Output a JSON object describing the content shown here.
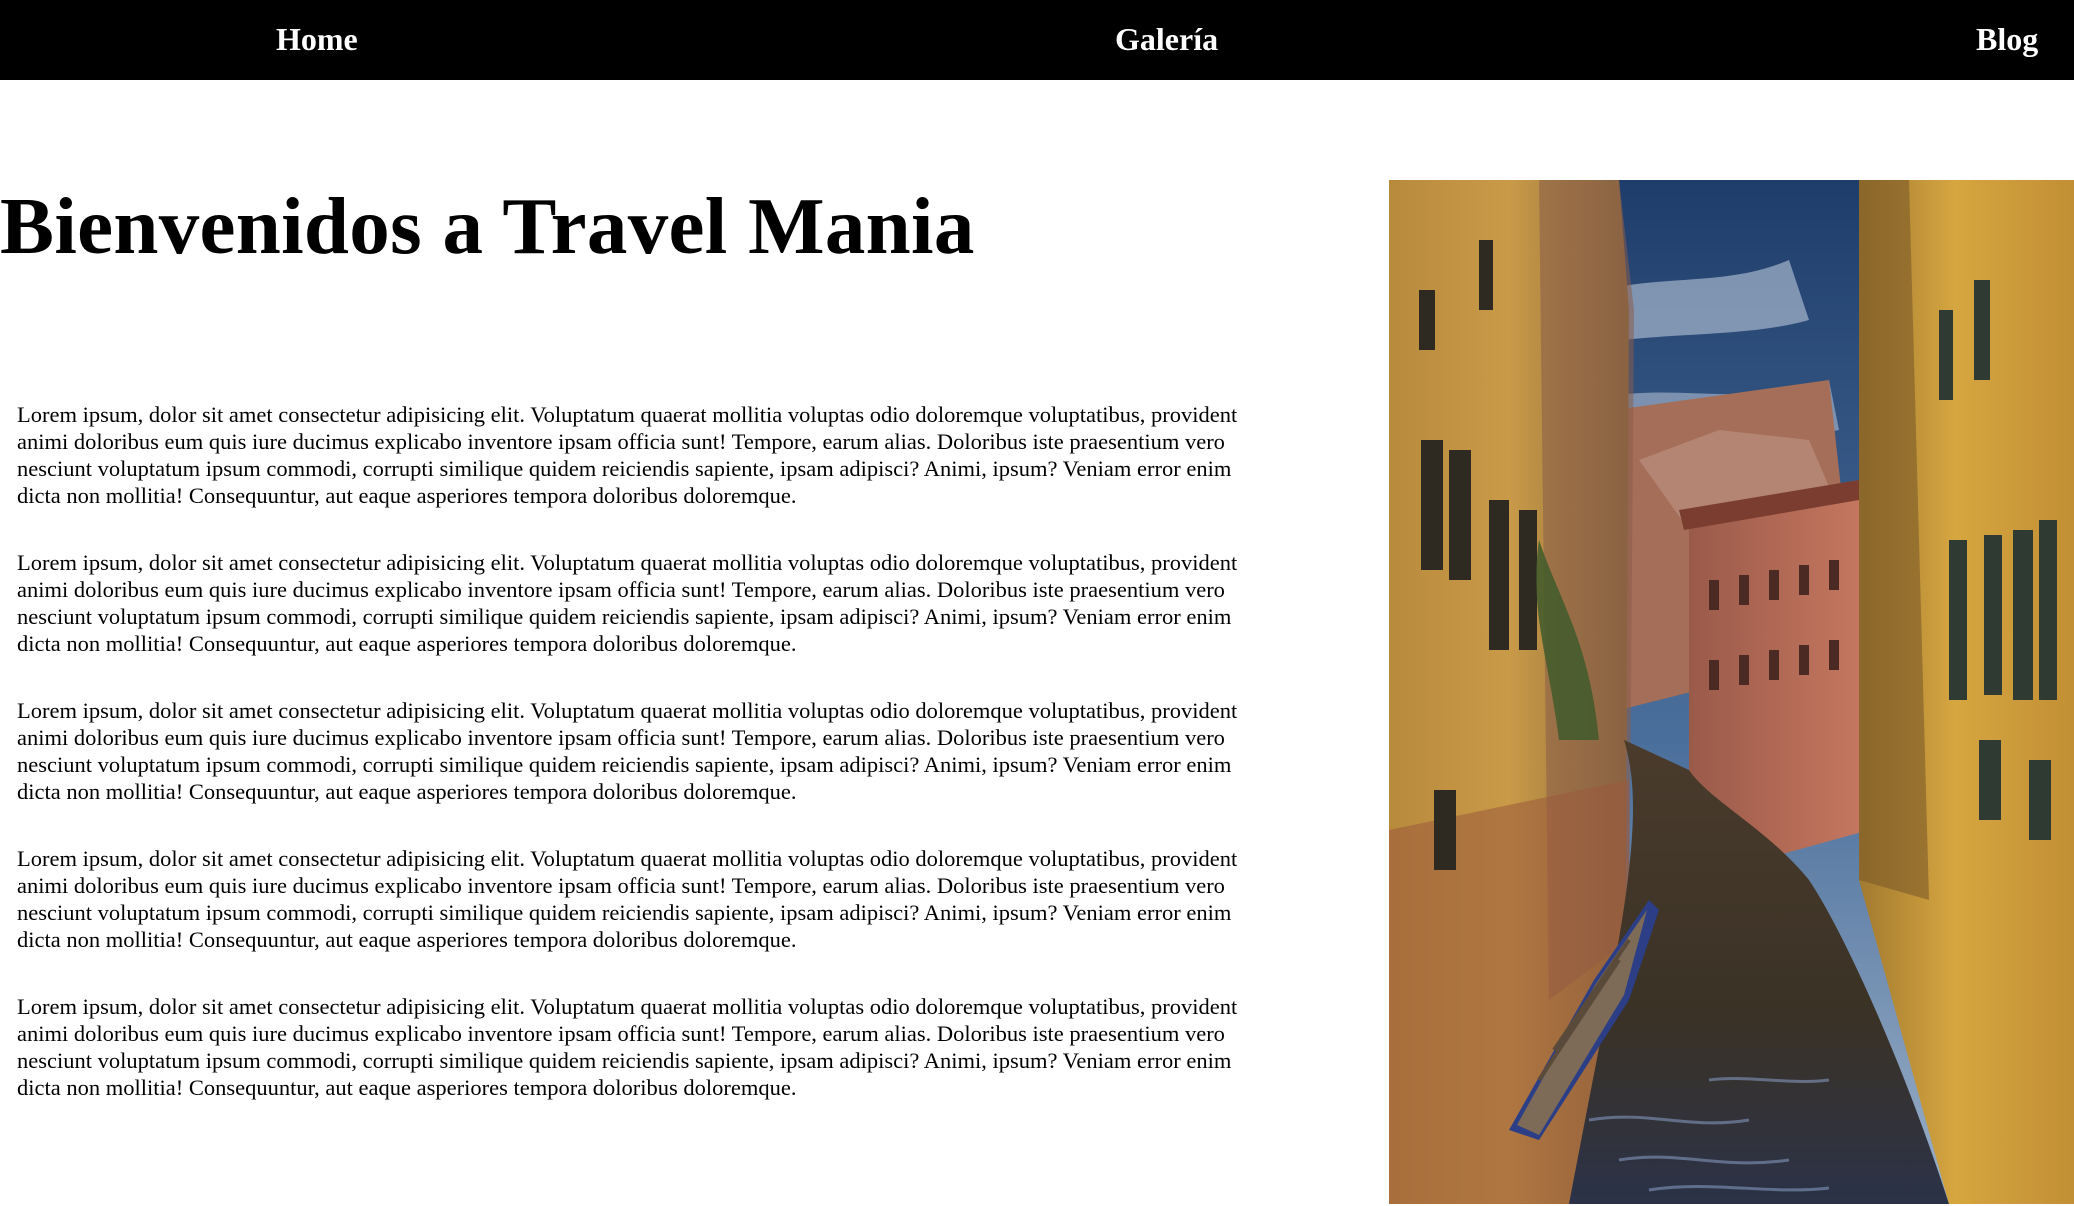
{
  "nav": {
    "items": [
      {
        "label": "Home"
      },
      {
        "label": "Galería"
      },
      {
        "label": "Blog"
      }
    ]
  },
  "main": {
    "title": "Bienvenidos a Travel Mania",
    "paragraphs": [
      "Lorem ipsum, dolor sit amet consectetur adipisicing elit. Voluptatum quaerat mollitia voluptas odio doloremque voluptatibus, provident animi doloribus eum quis iure ducimus explicabo inventore ipsam officia sunt! Tempore, earum alias. Doloribus iste praesentium vero nesciunt voluptatum ipsum commodi, corrupti similique quidem reiciendis sapiente, ipsam adipisci? Animi, ipsum? Veniam error enim dicta non mollitia! Consequuntur, aut eaque asperiores tempora doloribus doloremque.",
      "Lorem ipsum, dolor sit amet consectetur adipisicing elit. Voluptatum quaerat mollitia voluptas odio doloremque voluptatibus, provident animi doloribus eum quis iure ducimus explicabo inventore ipsam officia sunt! Tempore, earum alias. Doloribus iste praesentium vero nesciunt voluptatum ipsum commodi, corrupti similique quidem reiciendis sapiente, ipsam adipisci? Animi, ipsum? Veniam error enim dicta non mollitia! Consequuntur, aut eaque asperiores tempora doloribus doloremque.",
      "Lorem ipsum, dolor sit amet consectetur adipisicing elit. Voluptatum quaerat mollitia voluptas odio doloremque voluptatibus, provident animi doloribus eum quis iure ducimus explicabo inventore ipsam officia sunt! Tempore, earum alias. Doloribus iste praesentium vero nesciunt voluptatum ipsum commodi, corrupti similique quidem reiciendis sapiente, ipsam adipisci? Animi, ipsum? Veniam error enim dicta non mollitia! Consequuntur, aut eaque asperiores tempora doloribus doloremque.",
      "Lorem ipsum, dolor sit amet consectetur adipisicing elit. Voluptatum quaerat mollitia voluptas odio doloremque voluptatibus, provident animi doloribus eum quis iure ducimus explicabo inventore ipsam officia sunt! Tempore, earum alias. Doloribus iste praesentium vero nesciunt voluptatum ipsum commodi, corrupti similique quidem reiciendis sapiente, ipsam adipisci? Animi, ipsum? Veniam error enim dicta non mollitia! Consequuntur, aut eaque asperiores tempora doloribus doloremque.",
      "Lorem ipsum, dolor sit amet consectetur adipisicing elit. Voluptatum quaerat mollitia voluptas odio doloremque voluptatibus, provident animi doloribus eum quis iure ducimus explicabo inventore ipsam officia sunt! Tempore, earum alias. Doloribus iste praesentium vero nesciunt voluptatum ipsum commodi, corrupti similique quidem reiciendis sapiente, ipsam adipisci? Animi, ipsum? Veniam error enim dicta non mollitia! Consequuntur, aut eaque asperiores tempora doloribus doloremque."
    ]
  },
  "colors": {
    "nav_background": "#000000",
    "nav_text": "#ffffff",
    "page_background": "#ffffff",
    "text": "#000000"
  }
}
